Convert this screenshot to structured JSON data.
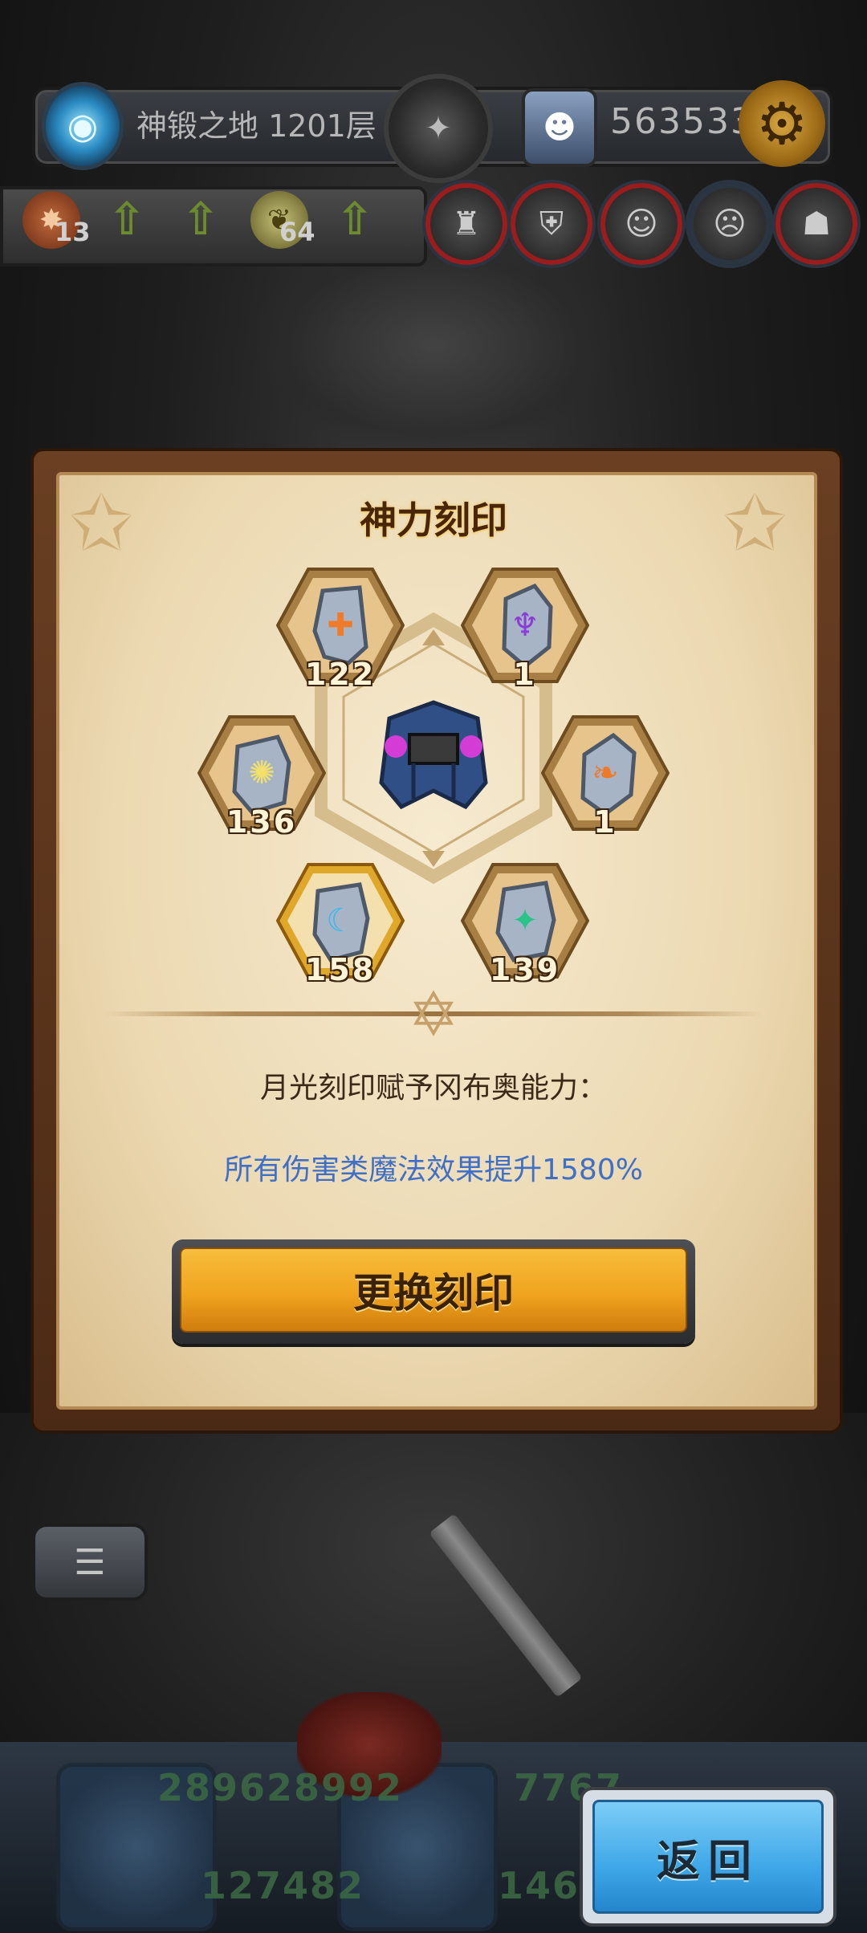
{
  "top_bar": {
    "location": "神锻之地 1201层",
    "gold": "563533",
    "portal_icon": "portal-icon",
    "gear_icon": "gear-icon"
  },
  "resources": [
    {
      "icon": "boot-icon",
      "count": "13"
    },
    {
      "icon": "upgrade-arrow-icon"
    },
    {
      "icon": "upgrade-arrow-icon"
    },
    {
      "icon": "wreath-icon",
      "count": "64"
    },
    {
      "icon": "upgrade-arrow-icon"
    }
  ],
  "hero_slots": [
    "knight-helmet",
    "armor",
    "goblin",
    "helmet-warrior",
    "masked-warrior"
  ],
  "panel": {
    "title": "神力刻印",
    "runes": [
      {
        "name": "flame",
        "count": "122",
        "color": "#f07b2a"
      },
      {
        "name": "void",
        "count": "1",
        "color": "#8a3bd8"
      },
      {
        "name": "sun",
        "count": "136",
        "color": "#f2e06a"
      },
      {
        "name": "fire-feather",
        "count": "1",
        "color": "#ee7a28"
      },
      {
        "name": "moon",
        "count": "158",
        "color": "#3ab8f0",
        "selected": true
      },
      {
        "name": "leaf",
        "count": "139",
        "color": "#2ac48a"
      }
    ],
    "description_label": "月光刻印赋予冈布奥能力：",
    "effect_text": "所有伤害类魔法效果提升1580%",
    "change_button": "更换刻印"
  },
  "bottom": {
    "num1": "289628992",
    "num2": "7767",
    "num3": "127482",
    "num4": "146",
    "return_button": "返回"
  }
}
